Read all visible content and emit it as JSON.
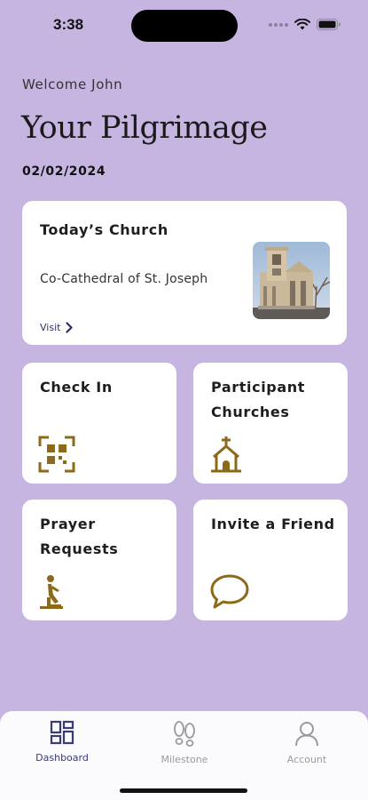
{
  "status": {
    "time": "3:38"
  },
  "header": {
    "welcome": "Welcome John",
    "title": "Your Pilgrimage",
    "date": "02/02/2024"
  },
  "today_card": {
    "title": "Today’s Church",
    "church_name": "Co-Cathedral of St. Joseph",
    "visit_label": "Visit"
  },
  "tiles": {
    "check_in": "Check In",
    "participant_churches": "Participant Churches",
    "prayer_requests": "Prayer Requests",
    "invite_friend": "Invite a Friend"
  },
  "tabbar": {
    "dashboard": "Dashboard",
    "milestone": "Milestone",
    "account": "Account"
  },
  "colors": {
    "background": "#c5b5e0",
    "icon_gold": "#8b6a1a",
    "active_tab": "#3a3a78",
    "inactive_tab": "#9a9a9a"
  },
  "icons": {
    "check_in": "qr-scan-icon",
    "participant_churches": "church-icon",
    "prayer_requests": "kneeling-prayer-icon",
    "invite_friend": "chat-bubble-icon",
    "dashboard": "dashboard-grid-icon",
    "milestone": "footprints-icon",
    "account": "person-icon"
  }
}
